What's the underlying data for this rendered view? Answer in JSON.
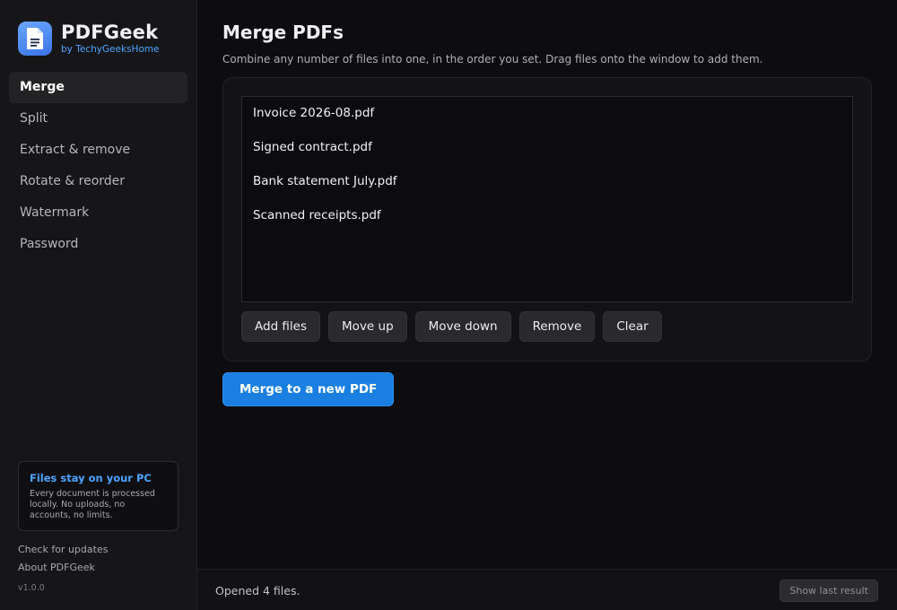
{
  "brand": {
    "name": "PDFGeek",
    "subtitle": "by TechyGeeksHome",
    "logo_icon": "document-icon"
  },
  "sidebar": {
    "items": [
      {
        "label": "Merge",
        "active": true
      },
      {
        "label": "Split",
        "active": false
      },
      {
        "label": "Extract & remove",
        "active": false
      },
      {
        "label": "Rotate & reorder",
        "active": false
      },
      {
        "label": "Watermark",
        "active": false
      },
      {
        "label": "Password",
        "active": false
      }
    ],
    "privacy_title": "Files stay on your PC",
    "privacy_body": "Every document is processed locally. No uploads, no accounts, no limits.",
    "links": {
      "updates": "Check for updates",
      "about": "About PDFGeek"
    },
    "version": "v1.0.0"
  },
  "main": {
    "title": "Merge PDFs",
    "description": "Combine any number of files into one, in the order you set. Drag files onto the window to add them.",
    "files": [
      "Invoice 2026-08.pdf",
      "Signed contract.pdf",
      "Bank statement July.pdf",
      "Scanned receipts.pdf"
    ],
    "buttons": {
      "add": "Add files",
      "move_up": "Move up",
      "move_down": "Move down",
      "remove": "Remove",
      "clear": "Clear"
    },
    "primary_action": "Merge to a new PDF"
  },
  "status": {
    "message": "Opened 4 files.",
    "show_last": "Show last result"
  },
  "colors": {
    "accent": "#1a7fe0",
    "brand_sub": "#4da3ff",
    "background": "#0d0d0f",
    "sidebar": "#161618"
  }
}
